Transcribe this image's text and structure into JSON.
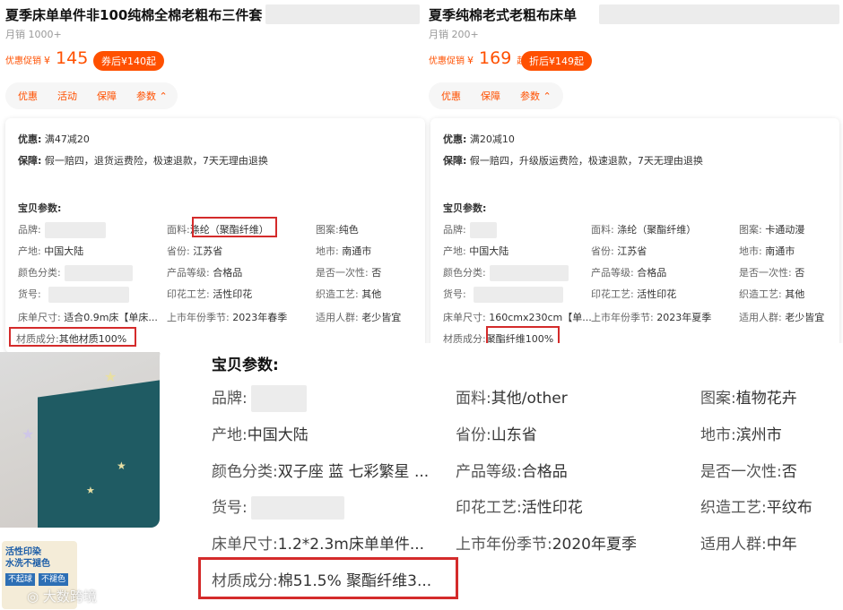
{
  "left": {
    "title": "夏季床单单件非100纯棉全棉老粗布三件套",
    "sales": "月销 1000+",
    "promo_label": "优惠促销",
    "currency": "¥",
    "price": "145",
    "price_suffix": "起",
    "coupon": "券后¥140起",
    "tabs": [
      "优惠",
      "活动",
      "保障",
      "参数 ⌃"
    ],
    "discount_label": "优惠:",
    "discount_value": "满47减20",
    "guarantee_label": "保障:",
    "guarantee_value": "假一赔四，退货运费险，极速退款，7天无理由退换",
    "params_title": "宝贝参数:",
    "params": [
      {
        "label": "品牌:",
        "value": ""
      },
      {
        "label": "面料:",
        "value": "涤纶（聚酯纤维）"
      },
      {
        "label": "图案:",
        "value": "纯色"
      },
      {
        "label": "产地:",
        "value": "中国大陆"
      },
      {
        "label": "省份:",
        "value": "江苏省"
      },
      {
        "label": "地市:",
        "value": "南通市"
      },
      {
        "label": "颜色分类:",
        "value": ""
      },
      {
        "label": "产品等级:",
        "value": "合格品"
      },
      {
        "label": "是否一次性:",
        "value": "否"
      },
      {
        "label": "货号:",
        "value": ""
      },
      {
        "label": "印花工艺:",
        "value": "活性印花"
      },
      {
        "label": "织造工艺:",
        "value": "其他"
      },
      {
        "label": "床单尺寸:",
        "value": "适合0.9m床【单床..."
      },
      {
        "label": "上市年份季节:",
        "value": "2023年春季"
      },
      {
        "label": "适用人群:",
        "value": "老少皆宜"
      },
      {
        "label": "材质成分:",
        "value": "其他材质100%"
      }
    ]
  },
  "right": {
    "title": "夏季纯棉老式老粗布床单",
    "sales": "月销 200+",
    "promo_label": "优惠促销",
    "currency": "¥",
    "price": "169",
    "price_suffix": "起",
    "coupon": "折后¥149起",
    "tabs": [
      "优惠",
      "保障",
      "参数 ⌃"
    ],
    "discount_label": "优惠:",
    "discount_value": "满20减10",
    "guarantee_label": "保障:",
    "guarantee_value": "假一赔四，升级版运费险，极速退款，7天无理由退换",
    "params_title": "宝贝参数:",
    "params": [
      {
        "label": "品牌:",
        "value": ""
      },
      {
        "label": "面料:",
        "value": "涤纶（聚酯纤维）"
      },
      {
        "label": "图案:",
        "value": "卡通动漫"
      },
      {
        "label": "产地:",
        "value": "中国大陆"
      },
      {
        "label": "省份:",
        "value": "江苏省"
      },
      {
        "label": "地市:",
        "value": "南通市"
      },
      {
        "label": "颜色分类:",
        "value": ""
      },
      {
        "label": "产品等级:",
        "value": "合格品"
      },
      {
        "label": "是否一次性:",
        "value": "否"
      },
      {
        "label": "货号:",
        "value": ""
      },
      {
        "label": "印花工艺:",
        "value": "活性印花"
      },
      {
        "label": "织造工艺:",
        "value": "其他"
      },
      {
        "label": "床单尺寸:",
        "value": "160cmx230cm【单..."
      },
      {
        "label": "上市年份季节:",
        "value": "2023年夏季"
      },
      {
        "label": "适用人群:",
        "value": "老少皆宜"
      },
      {
        "label": "材质成分:",
        "value": "聚酯纤维100%"
      }
    ]
  },
  "bottom": {
    "params_title": "宝贝参数:",
    "params": [
      {
        "label": "品牌:",
        "value": ""
      },
      {
        "label": "面料:",
        "value": "其他/other"
      },
      {
        "label": "图案:",
        "value": "植物花卉"
      },
      {
        "label": "产地:",
        "value": "中国大陆"
      },
      {
        "label": "省份:",
        "value": "山东省"
      },
      {
        "label": "地市:",
        "value": "滨州市"
      },
      {
        "label": "颜色分类:",
        "value": "双子座 蓝 七彩繁星 ..."
      },
      {
        "label": "产品等级:",
        "value": "合格品"
      },
      {
        "label": "是否一次性:",
        "value": "否"
      },
      {
        "label": "货号:",
        "value": ""
      },
      {
        "label": "印花工艺:",
        "value": "活性印花"
      },
      {
        "label": "织造工艺:",
        "value": "平纹布"
      },
      {
        "label": "床单尺寸:",
        "value": "1.2*2.3m床单单件..."
      },
      {
        "label": "上市年份季节:",
        "value": "2020年夏季"
      },
      {
        "label": "适用人群:",
        "value": "中年"
      },
      {
        "label": "材质成分:",
        "value": "棉51.5% 聚酯纤维3..."
      }
    ]
  },
  "thumb": {
    "line1": "活性印染",
    "line2": "水洗不褪色",
    "tag1": "不起球",
    "tag2": "不褪色"
  },
  "watermark": "大数跨境",
  "colors": {
    "accent": "#ff5000",
    "highlight_border": "#d42b2b",
    "cloth": "#1f5b63"
  }
}
